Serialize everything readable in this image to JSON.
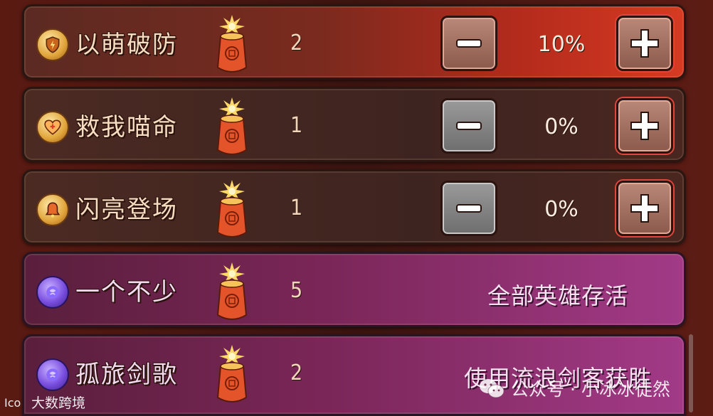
{
  "rows": [
    {
      "name": "以萌破防",
      "count": "2",
      "percent": "10%",
      "type": "adjust",
      "minus_enabled": true,
      "theme": "red",
      "badge": "shield-badge-icon"
    },
    {
      "name": "救我喵命",
      "count": "1",
      "percent": "0%",
      "type": "adjust",
      "minus_enabled": false,
      "theme": "brown",
      "badge": "heart-badge-icon"
    },
    {
      "name": "闪亮登场",
      "count": "1",
      "percent": "0%",
      "type": "adjust",
      "minus_enabled": false,
      "theme": "brown",
      "badge": "bell-badge-icon"
    },
    {
      "name": "一个不少",
      "count": "5",
      "condition": "全部英雄存活",
      "type": "condition",
      "theme": "purple",
      "badge": "orb-badge-icon"
    },
    {
      "name": "孤旅剑歌",
      "count": "2",
      "condition": "使用流浪剑客获胜",
      "type": "condition",
      "theme": "purple",
      "badge": "orb-badge-icon"
    }
  ],
  "watermark": {
    "left_text": "大数跨境",
    "right_text": "公众号 · 小冰冰徒然"
  },
  "colors": {
    "red_row": "#b42b1c",
    "purple_row": "#a23a87",
    "text": "#f6dcc0"
  }
}
